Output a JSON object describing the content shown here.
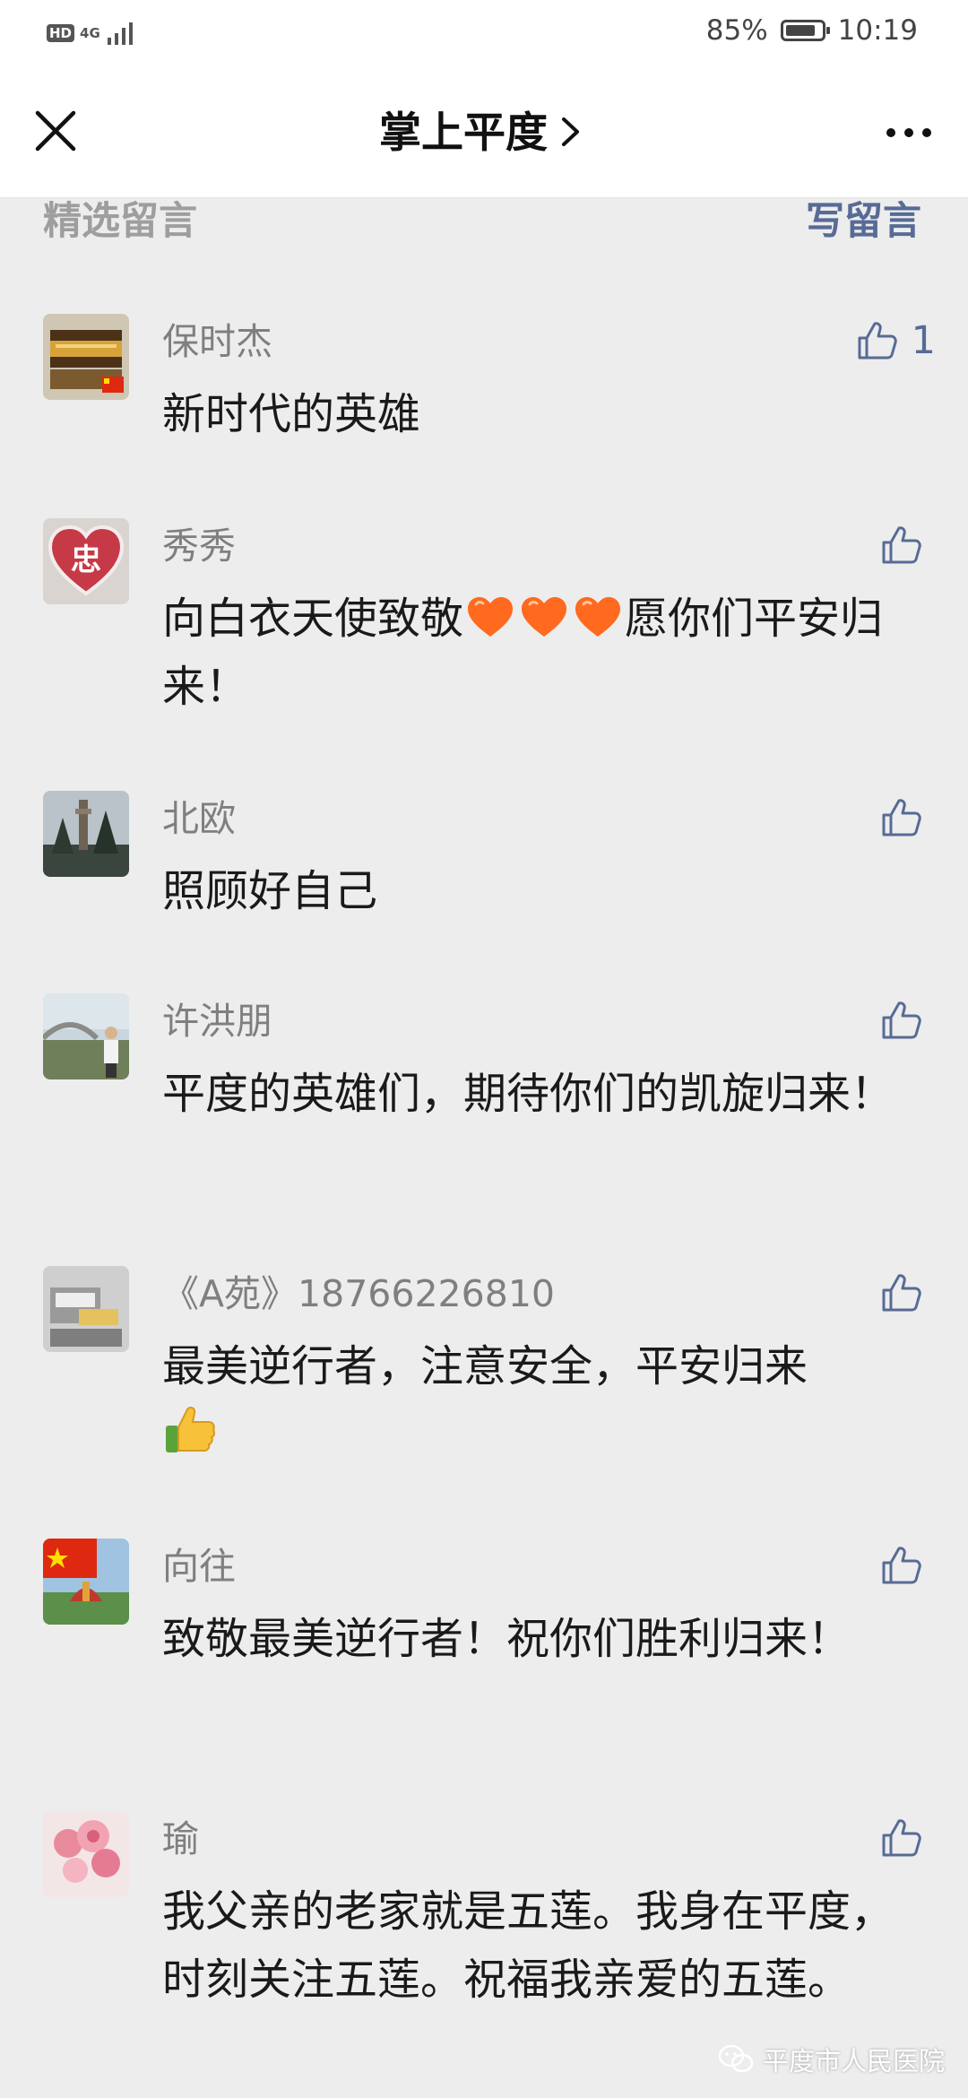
{
  "status_bar": {
    "hd": "HD",
    "network": "4G",
    "battery": "85%",
    "battery_level": 0.85,
    "time": "10:19"
  },
  "nav": {
    "title": "掌上平度"
  },
  "section": {
    "title": "精选留言",
    "write": "写留言"
  },
  "comments": [
    {
      "name": "保时杰",
      "segments": [
        "新时代的英雄"
      ],
      "likes": "1"
    },
    {
      "name": "秀秀",
      "segments": [
        "向白衣天使致敬",
        "愿你们平安归来！"
      ],
      "emoji": "heart",
      "emoji_count": 3,
      "likes": ""
    },
    {
      "name": "北欧",
      "segments": [
        "照顾好自己"
      ],
      "likes": ""
    },
    {
      "name": "许洪朋",
      "segments": [
        "平度的英雄们，期待你们的凯旋归来！"
      ],
      "likes": ""
    },
    {
      "name": "《A苑》18766226810",
      "segments": [
        "最美逆行者，注意安全，平安归来"
      ],
      "emoji": "thumbs-up",
      "likes": ""
    },
    {
      "name": "向往",
      "segments": [
        "致敬最美逆行者！祝你们胜利归来！"
      ],
      "likes": ""
    },
    {
      "name": "瑜",
      "segments": [
        "我父亲的老家就是五莲。我身在平度，时刻关注五莲。祝福我亲爱的五莲。"
      ],
      "likes": ""
    }
  ],
  "avatar_labels": {
    "xiuxiu": "忠"
  },
  "watermark": "平度市人民医院",
  "colors": {
    "link": "#576b95",
    "background": "#ededed",
    "heart": "#ff6a1f"
  }
}
